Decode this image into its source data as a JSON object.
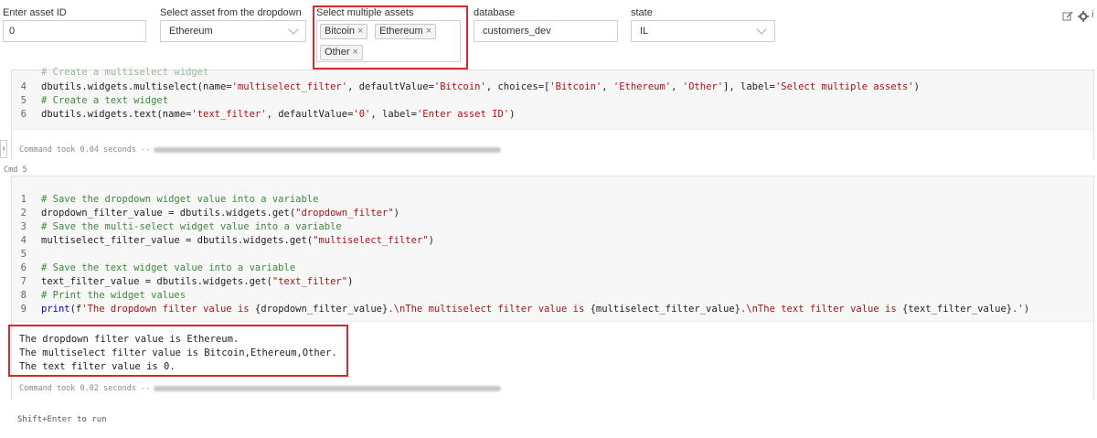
{
  "widgets": {
    "asset_id": {
      "label": "Enter asset ID",
      "value": "0"
    },
    "dropdown": {
      "label": "Select asset from the dropdown",
      "value": "Ethereum"
    },
    "multiselect": {
      "label": "Select multiple assets",
      "tags": [
        "Bitcoin",
        "Ethereum",
        "Other"
      ]
    },
    "database": {
      "label": "database",
      "value": "customers_dev"
    },
    "state": {
      "label": "state",
      "value": "IL"
    }
  },
  "cell1": {
    "lines": [
      {
        "n": "4",
        "text": "dbutils.widgets.multiselect(name='multiselect_filter', defaultValue='Bitcoin', choices=['Bitcoin', 'Ethereum', 'Other'], label='Select multiple assets')"
      },
      {
        "n": "5",
        "text": "# Create a text widget"
      },
      {
        "n": "6",
        "text": "dbutils.widgets.text(name='text_filter', defaultValue='0', label='Enter asset ID')"
      }
    ],
    "partial_comment": "# Create a multiselect widget",
    "command_took": "Command took 0.04 seconds --"
  },
  "cmd_label": "Cmd 5",
  "cell2": {
    "lines": [
      {
        "n": "1",
        "text": "# Save the dropdown widget value into a variable"
      },
      {
        "n": "2",
        "text": "dropdown_filter_value = dbutils.widgets.get(\"dropdown_filter\")"
      },
      {
        "n": "3",
        "text": "# Save the multi-select widget value into a variable"
      },
      {
        "n": "4",
        "text": "multiselect_filter_value = dbutils.widgets.get(\"multiselect_filter\")"
      },
      {
        "n": "5",
        "text": ""
      },
      {
        "n": "6",
        "text": "# Save the text widget value into a variable"
      },
      {
        "n": "7",
        "text": "text_filter_value = dbutils.widgets.get(\"text_filter\")"
      },
      {
        "n": "8",
        "text": "# Print the widget values"
      },
      {
        "n": "9",
        "text": "print(f'The dropdown filter value is {dropdown_filter_value}.\\nThe multiselect filter value is {multiselect_filter_value}.\\nThe text filter value is {text_filter_value}.')"
      }
    ],
    "output": [
      "The dropdown filter value is Ethereum.",
      "The multiselect filter value is Bitcoin,Ethereum,Other.",
      "The text filter value is 0."
    ],
    "command_took": "Command took 0.02 seconds --"
  },
  "footer_hint": "Shift+Enter to run",
  "icons": [
    "edit-icon",
    "gear-icon",
    "info-icon",
    "collapse-arrow-icon"
  ]
}
